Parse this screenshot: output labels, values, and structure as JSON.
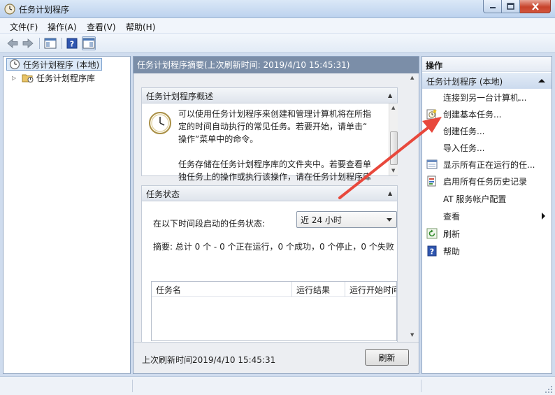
{
  "window": {
    "title": "任务计划程序"
  },
  "menubar": {
    "items": [
      "文件(F)",
      "操作(A)",
      "查看(V)",
      "帮助(H)"
    ]
  },
  "toolbar": {
    "icons": [
      "back-arrow-icon",
      "forward-arrow-icon",
      "console-tree-icon",
      "help-icon",
      "action-pane-icon"
    ]
  },
  "tree": {
    "root": "任务计划程序 (本地)",
    "child": "任务计划程序库"
  },
  "center": {
    "header": "任务计划程序摘要(上次刷新时间: 2019/4/10 15:45:31)",
    "overview": {
      "title": "任务计划程序概述",
      "para1_line1": "可以使用任务计划程序来创建和管理计算机将在所指",
      "para1_line2": "定的时间自动执行的常见任务。若要开始，请单击“",
      "para1_line3": "操作”菜单中的命令。",
      "para2_line1": "任务存储在任务计划程序库的文件夹中。若要查看单",
      "para2_line2": "独任务上的操作或执行该操作，请在任务计划程序库"
    },
    "status": {
      "title": "任务状态",
      "period_label": "在以下时间段启动的任务状态:",
      "period_value": "近 24 小时",
      "summary": "摘要: 总计 0 个 - 0 个正在运行，0 个成功，0 个停止，0 个失败",
      "columns": [
        "任务名",
        "运行结果",
        "运行开始时间"
      ]
    },
    "footer": {
      "last_refresh": "上次刷新时间2019/4/10 15:45:31",
      "refresh_button": "刷新"
    }
  },
  "actions": {
    "title": "操作",
    "group": "任务计划程序 (本地)",
    "items": [
      {
        "label": "连接到另一台计算机...",
        "icon": ""
      },
      {
        "label": "创建基本任务...",
        "icon": "create-basic-task-icon"
      },
      {
        "label": "创建任务...",
        "icon": ""
      },
      {
        "label": "导入任务...",
        "icon": ""
      },
      {
        "label": "显示所有正在运行的任...",
        "icon": "running-tasks-icon"
      },
      {
        "label": "启用所有任务历史记录",
        "icon": "task-history-icon"
      },
      {
        "label": "AT 服务帐户配置",
        "icon": ""
      },
      {
        "label": "查看",
        "icon": ""
      },
      {
        "label": "刷新",
        "icon": "refresh-icon"
      },
      {
        "label": "帮助",
        "icon": "help-icon"
      }
    ]
  },
  "colors": {
    "header_bar": "#7b8ea8",
    "annotation_arrow": "#e8483c",
    "close_button": "#c7432b"
  }
}
